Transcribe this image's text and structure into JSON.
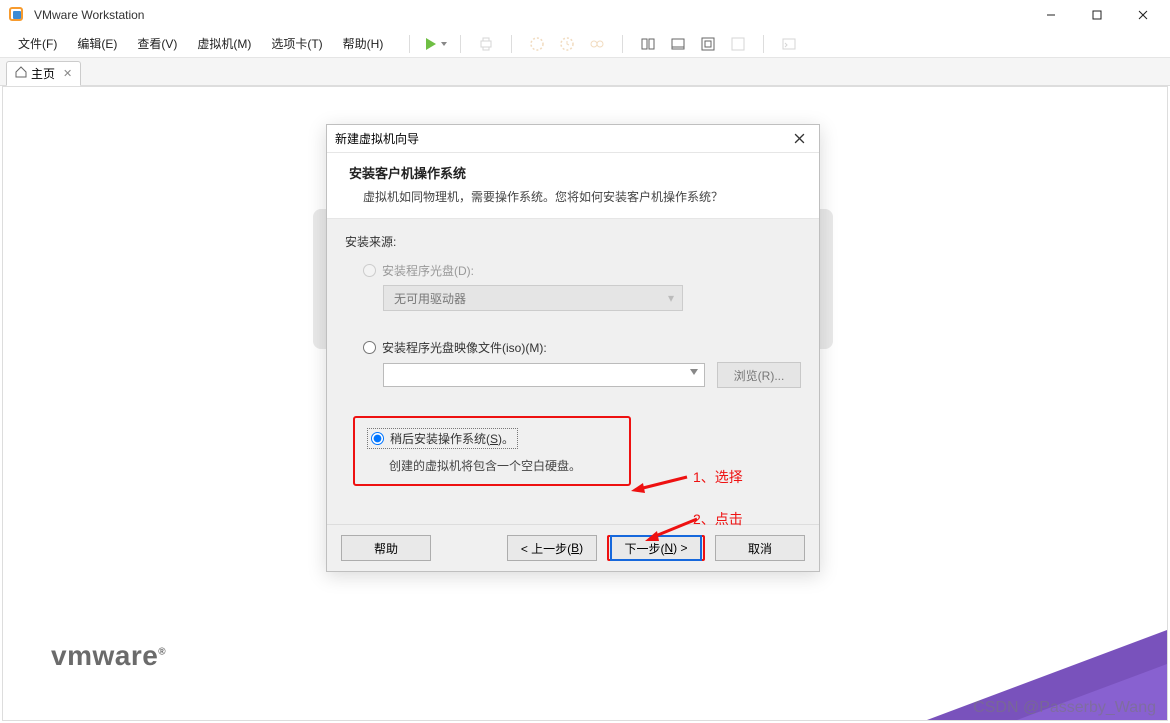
{
  "app": {
    "title": "VMware Workstation"
  },
  "menu": {
    "file": "文件(F)",
    "edit": "编辑(E)",
    "view": "查看(V)",
    "vm": "虚拟机(M)",
    "tabs": "选项卡(T)",
    "help": "帮助(H)"
  },
  "tab": {
    "home": "主页"
  },
  "dialog": {
    "title": "新建虚拟机向导",
    "heading": "安装客户机操作系统",
    "subheading": "虚拟机如同物理机，需要操作系统。您将如何安装客户机操作系统？",
    "source_label": "安装来源:",
    "opt_disc": "安装程序光盘(D):",
    "disc_empty": "无可用驱动器",
    "opt_iso": "安装程序光盘映像文件(iso)(M):",
    "browse": "浏览(R)...",
    "opt_later_prefix": "稍后安装操作系统(",
    "opt_later_underline": "S",
    "opt_later_suffix": ")。",
    "later_desc": "创建的虚拟机将包含一个空白硬盘。",
    "annot1": "1、选择",
    "annot2": "2、点击",
    "btn_help": "帮助",
    "btn_back_prefix": "< 上一步(",
    "btn_back_u": "B",
    "btn_back_suffix": ")",
    "btn_next_prefix": "下一步(",
    "btn_next_u": "N",
    "btn_next_suffix": ") >",
    "btn_cancel": "取消"
  },
  "footer": {
    "logo": "vmware",
    "watermark": "CSDN @Passerby_Wang"
  }
}
